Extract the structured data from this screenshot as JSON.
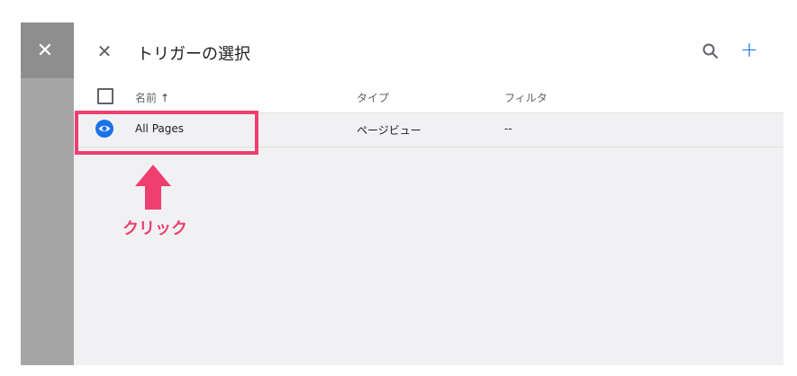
{
  "panel": {
    "title": "トリガーの選択"
  },
  "table": {
    "columns": {
      "name": "名前",
      "sort_indicator": "↑",
      "type": "タイプ",
      "filter": "フィルタ"
    },
    "rows": [
      {
        "name": "All Pages",
        "type": "ページビュー",
        "filter": "--"
      }
    ]
  },
  "annotation": {
    "label": "クリック",
    "color": "#ee3f70"
  },
  "colors": {
    "accent": "#1a73e8",
    "highlight": "#ee3f70"
  },
  "icons": {
    "close": "close-icon",
    "search": "search-icon",
    "add": "add-icon",
    "row_type": "eye-icon"
  }
}
